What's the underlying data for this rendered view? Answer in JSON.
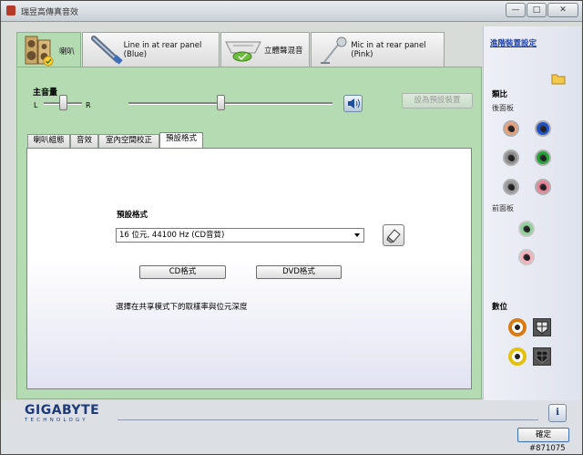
{
  "window": {
    "title": "瑞昱高傳真音效",
    "min": "—",
    "max": "□",
    "close": "✕"
  },
  "device_tabs": [
    {
      "label": "喇叭"
    },
    {
      "label": "Line in at rear panel (Blue)"
    },
    {
      "label": "立體聲混音"
    },
    {
      "label": "Mic in at rear panel (Pink)"
    }
  ],
  "volume": {
    "label": "主音量",
    "left": "L",
    "right": "R",
    "balance": 0.5,
    "level": 0.45
  },
  "set_default_button": "設為預設裝置",
  "sub_tabs": [
    "喇叭組態",
    "音效",
    "室內空間校正",
    "預設格式"
  ],
  "format": {
    "label": "預設格式",
    "selected": "16 位元, 44100 Hz (CD音質)",
    "cd_button": "CD格式",
    "dvd_button": "DVD格式",
    "description": "選擇在共享模式下的取樣率與位元深度"
  },
  "right_panel": {
    "advanced_link": "進階裝置設定",
    "analog_label": "類比",
    "rear_label": "後面板",
    "front_label": "前面板",
    "digital_label": "數位",
    "rear_jack_colors": [
      "#e8a07a",
      "#1f52c9",
      "#8f8f8f",
      "#27a33a",
      "#9a9a9a",
      "#e7849a"
    ],
    "front_jack_colors": [
      "#8fcf99",
      "#f2b3bf"
    ]
  },
  "footer": {
    "brand": "GIGABYTE",
    "brand_sub": "TECHNOLOGY",
    "info": "i",
    "ok_button": "確定",
    "watermark": "#871075"
  }
}
